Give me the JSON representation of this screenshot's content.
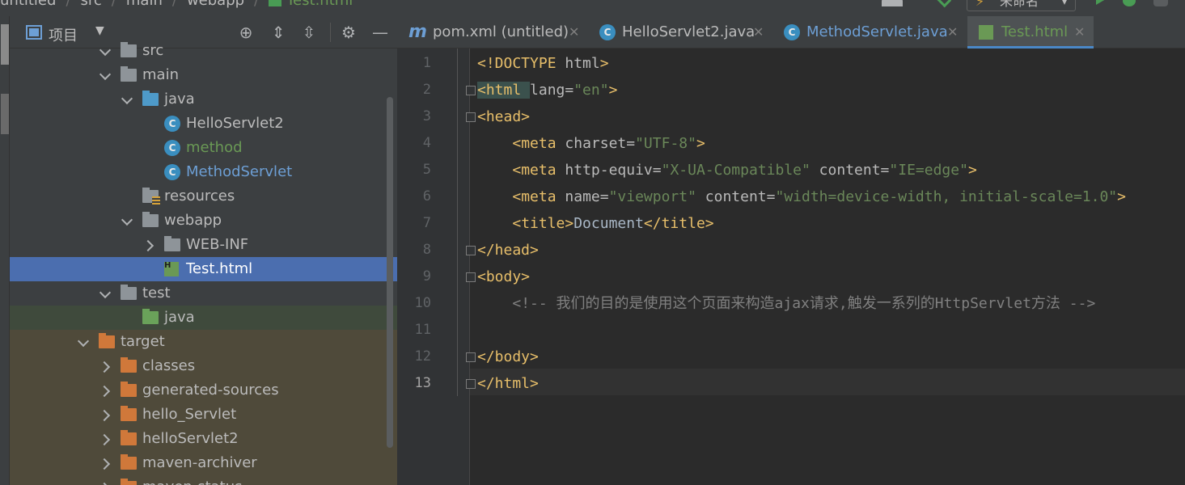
{
  "breadcrumb": {
    "items": [
      "untitled",
      "src",
      "main",
      "webapp",
      "Test.html"
    ]
  },
  "run_config": {
    "label": "未命名"
  },
  "project_panel": {
    "title": "项目",
    "tree": [
      {
        "label": "src",
        "depth": 2,
        "type": "folder",
        "state": "open"
      },
      {
        "label": "main",
        "depth": 2,
        "type": "folder",
        "state": "open"
      },
      {
        "label": "java",
        "depth": 3,
        "type": "folder-blue",
        "state": "open"
      },
      {
        "label": "HelloServlet2",
        "depth": 4,
        "type": "class",
        "color": "normal"
      },
      {
        "label": "method",
        "depth": 4,
        "type": "class",
        "color": "green"
      },
      {
        "label": "MethodServlet",
        "depth": 4,
        "type": "class",
        "color": "blue"
      },
      {
        "label": "resources",
        "depth": 3,
        "type": "folder-resources"
      },
      {
        "label": "webapp",
        "depth": 3,
        "type": "folder",
        "state": "open"
      },
      {
        "label": "WEB-INF",
        "depth": 4,
        "type": "folder",
        "state": "closed"
      },
      {
        "label": "Test.html",
        "depth": 4,
        "type": "html",
        "selected": true
      },
      {
        "label": "test",
        "depth": 2,
        "type": "folder",
        "state": "open"
      },
      {
        "label": "java",
        "depth": 3,
        "type": "folder-green"
      },
      {
        "label": "target",
        "depth": 1,
        "type": "folder-orange",
        "state": "open"
      },
      {
        "label": "classes",
        "depth": 2,
        "type": "folder-orange",
        "state": "closed"
      },
      {
        "label": "generated-sources",
        "depth": 2,
        "type": "folder-orange",
        "state": "closed"
      },
      {
        "label": "hello_Servlet",
        "depth": 2,
        "type": "folder-orange",
        "state": "closed"
      },
      {
        "label": "helloServlet2",
        "depth": 2,
        "type": "folder-orange",
        "state": "closed"
      },
      {
        "label": "maven-archiver",
        "depth": 2,
        "type": "folder-orange",
        "state": "closed"
      },
      {
        "label": "maven-status",
        "depth": 2,
        "type": "folder-orange",
        "state": "closed"
      }
    ]
  },
  "tabs": [
    {
      "label": "pom.xml (untitled)",
      "icon": "maven-icon",
      "color": "normal"
    },
    {
      "label": "HelloServlet2.java",
      "icon": "class-icon",
      "color": "normal"
    },
    {
      "label": "MethodServlet.java",
      "icon": "class-icon",
      "color": "blue"
    },
    {
      "label": "Test.html",
      "icon": "html-file-icon",
      "color": "green",
      "active": true
    }
  ],
  "editor": {
    "line_numbers": [
      "1",
      "2",
      "3",
      "4",
      "5",
      "6",
      "7",
      "8",
      "9",
      "10",
      "11",
      "12",
      "13"
    ],
    "current_line": "13",
    "lines": [
      [
        [
          "tg",
          "<!DOCTYPE "
        ],
        [
          "at",
          "html"
        ],
        [
          "tg",
          ">"
        ]
      ],
      [
        [
          "tg",
          "<html "
        ],
        [
          "at",
          "lang="
        ],
        [
          "av",
          "\"en\""
        ],
        [
          "tg",
          ">"
        ]
      ],
      [
        [
          "tg",
          "<head>"
        ]
      ],
      [
        [
          "txt",
          "    "
        ],
        [
          "tg",
          "<meta "
        ],
        [
          "at",
          "charset="
        ],
        [
          "av",
          "\"UTF-8\""
        ],
        [
          "tg",
          ">"
        ]
      ],
      [
        [
          "txt",
          "    "
        ],
        [
          "tg",
          "<meta "
        ],
        [
          "at",
          "http-equiv="
        ],
        [
          "av",
          "\"X-UA-Compatible\""
        ],
        [
          "at",
          " content="
        ],
        [
          "av",
          "\"IE=edge\""
        ],
        [
          "tg",
          ">"
        ]
      ],
      [
        [
          "txt",
          "    "
        ],
        [
          "tg",
          "<meta "
        ],
        [
          "at",
          "name="
        ],
        [
          "av",
          "\"viewport\""
        ],
        [
          "at",
          " content="
        ],
        [
          "av",
          "\"width=device-width, initial-scale=1.0\""
        ],
        [
          "tg",
          ">"
        ]
      ],
      [
        [
          "txt",
          "    "
        ],
        [
          "tg",
          "<title>"
        ],
        [
          "txt",
          "Document"
        ],
        [
          "tg",
          "</title>"
        ]
      ],
      [
        [
          "tg",
          "</head>"
        ]
      ],
      [
        [
          "tg",
          "<body>"
        ]
      ],
      [
        [
          "txt",
          "    "
        ],
        [
          "cm",
          "<!-- 我们的目的是使用这个页面来构造ajax请求,触发一系列的HttpServlet方法 -->"
        ]
      ],
      [],
      [
        [
          "tg",
          "</body>"
        ]
      ],
      [
        [
          "tg",
          "</html"
        ],
        [
          "tg",
          ">"
        ]
      ]
    ]
  }
}
